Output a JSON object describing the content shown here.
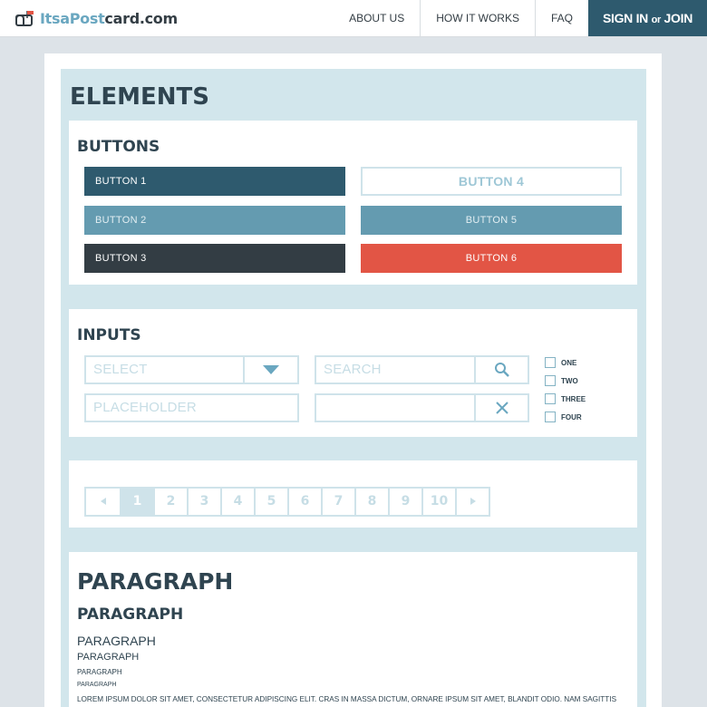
{
  "header": {
    "logo": {
      "part1": "ItsaPost",
      "part2": "card.com"
    },
    "nav": [
      "ABOUT US",
      "HOW IT WORKS",
      "FAQ"
    ],
    "signin": {
      "pre": "SIGN IN ",
      "or": "or",
      "post": " JOIN"
    }
  },
  "page": {
    "title": "ELEMENTS"
  },
  "buttons": {
    "title": "BUTTONS",
    "items": [
      "BUTTON 1",
      "BUTTON 2",
      "BUTTON 3",
      "BUTTON 4",
      "BUTTON 5",
      "BUTTON 6"
    ]
  },
  "inputs": {
    "title": "INPUTS",
    "select_label": "SELECT",
    "search_placeholder": "SEARCH",
    "text_placeholder": "PLACEHOLDER",
    "clear_value": "",
    "checkboxes": [
      "ONE",
      "TWO",
      "THREE",
      "FOUR"
    ]
  },
  "pagination": {
    "pages": [
      "1",
      "2",
      "3",
      "4",
      "5",
      "6",
      "7",
      "8",
      "9",
      "10"
    ],
    "current": "1",
    "prev_icon": "chevron-left-icon",
    "next_icon": "chevron-right-icon"
  },
  "paragraph": {
    "headings": [
      "PARAGRAPH",
      "PARAGRAPH",
      "PARAGRAPH",
      "PARAGRAPH",
      "PARAGRAPH",
      "PARAGRAPH"
    ],
    "body": "LOREM IPSUM DOLOR SIT AMET, CONSECTETUR ADIPISCING ELIT. CRAS IN MASSA DICTUM, ORNARE IPSUM SIT AMET, BLANDIT ODIO. NAM SAGITTIS"
  },
  "colors": {
    "button1": "#2e5a6e",
    "button2": "#649bb0",
    "button3": "#333d44",
    "button4_border": "#cfe3ea",
    "button4_text": "#9ec7d6",
    "button5": "#649bb0",
    "button6": "#e25545",
    "panel": "#d2e6ec",
    "accent": "#6aa7c0"
  }
}
